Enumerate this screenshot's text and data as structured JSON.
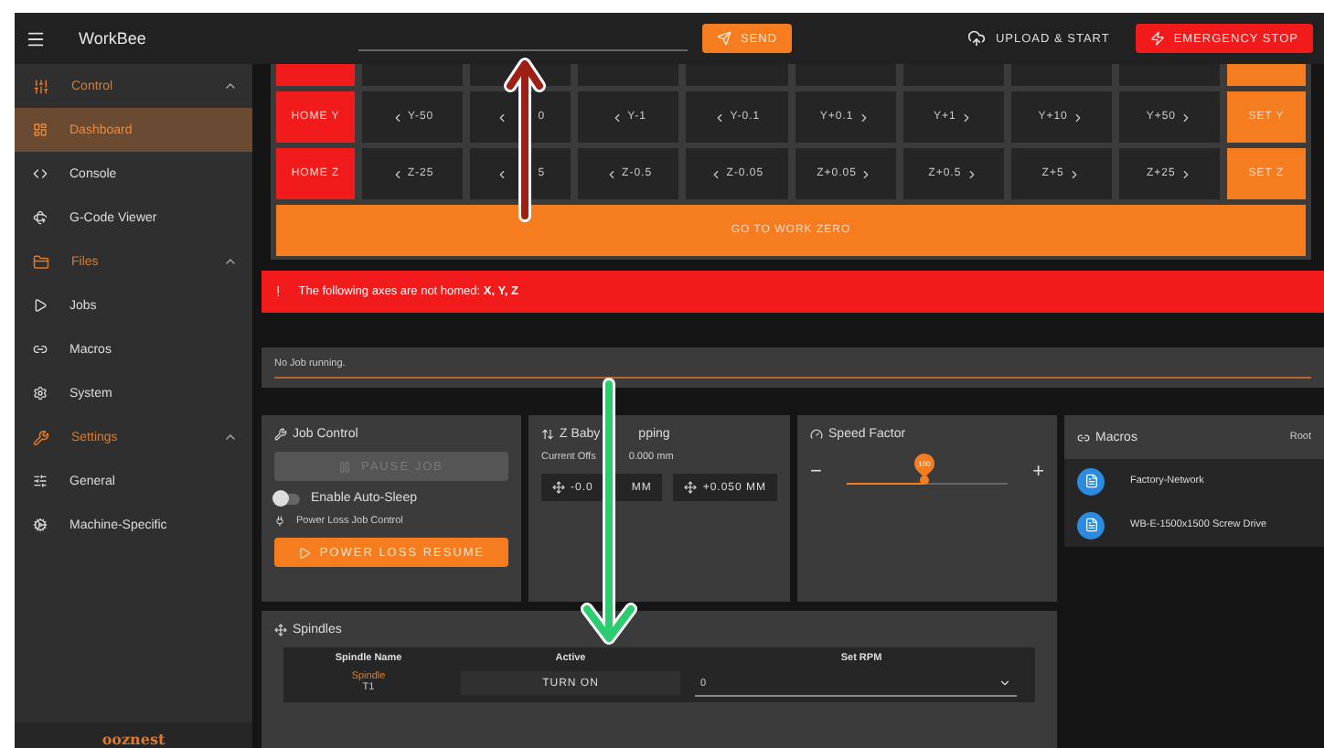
{
  "app_bar": {
    "title": "WorkBee",
    "send": "SEND",
    "upload": "UPLOAD & START",
    "stop": "EMERGENCY STOP"
  },
  "sidebar": {
    "sections": [
      {
        "label": "Control",
        "expanded": true,
        "items": [
          {
            "label": "Dashboard",
            "selected": true
          },
          {
            "label": "Console",
            "selected": false
          },
          {
            "label": "G-Code Viewer",
            "selected": false
          }
        ]
      },
      {
        "label": "Files",
        "expanded": true,
        "items": [
          {
            "label": "Jobs",
            "selected": false
          },
          {
            "label": "Macros",
            "selected": false
          },
          {
            "label": "System",
            "selected": false
          }
        ]
      },
      {
        "label": "Settings",
        "expanded": true,
        "items": [
          {
            "label": "General",
            "selected": false
          },
          {
            "label": "Machine-Specific",
            "selected": false
          }
        ]
      }
    ],
    "logo": "ooznest"
  },
  "jog": {
    "rows": [
      {
        "home": "HOME Y",
        "steps": [
          {
            "label": "Y-50",
            "covered": false
          },
          {
            "label": "0",
            "covered": true
          },
          {
            "label": "Y-1",
            "covered": false
          },
          {
            "label": "Y-0.1",
            "covered": false
          },
          {
            "label": "Y+0.1",
            "covered": false
          },
          {
            "label": "Y+1",
            "covered": false
          },
          {
            "label": "Y+10",
            "covered": false
          },
          {
            "label": "Y+50",
            "covered": false
          }
        ],
        "set": "SET Y"
      },
      {
        "home": "HOME Z",
        "steps": [
          {
            "label": "Z-25",
            "covered": false
          },
          {
            "label": "5",
            "covered": true
          },
          {
            "label": "Z-0.5",
            "covered": false
          },
          {
            "label": "Z-0.05",
            "covered": false
          },
          {
            "label": "Z+0.05",
            "covered": false
          },
          {
            "label": "Z+0.5",
            "covered": false
          },
          {
            "label": "Z+5",
            "covered": false
          },
          {
            "label": "Z+25",
            "covered": false
          }
        ],
        "set": "SET Z"
      }
    ],
    "work_zero": "GO TO WORK ZERO"
  },
  "alert": {
    "mark": "!",
    "text": "The following axes are not homed: **X, Y, Z**"
  },
  "job_status": {
    "text": "No Job running."
  },
  "job_control": {
    "title": "Job Control",
    "pause": {
      "label": "PAUSE JOB",
      "disabled": true
    },
    "auto_sleep": {
      "label": "Enable Auto-Sleep",
      "on": false
    },
    "power_loss_label": "Power Loss Job Control",
    "resume": "POWER LOSS RESUME"
  },
  "babystepping": {
    "title": [
      "Z Baby",
      "pping"
    ],
    "offset": [
      "Current Offs",
      "0.000 mm"
    ],
    "buttons": [
      [
        "-0.0",
        "MM"
      ],
      [
        "+0.050 MM"
      ]
    ]
  },
  "speed_factor": {
    "title": "Speed Factor",
    "minus": "−",
    "plus": "+",
    "value": "100",
    "level": 0.48
  },
  "macros": {
    "title": "Macros",
    "path": "Root",
    "items": [
      "Factory-Network",
      "WB-E-1500x1500 Screw Drive"
    ]
  },
  "spindles": {
    "title": "Spindles",
    "columns": [
      "Spindle Name",
      "Active",
      "Set RPM"
    ],
    "rows": [
      {
        "name": "Spindle",
        "tool": "T1",
        "action": "TURN ON",
        "rpm": "0"
      }
    ]
  }
}
